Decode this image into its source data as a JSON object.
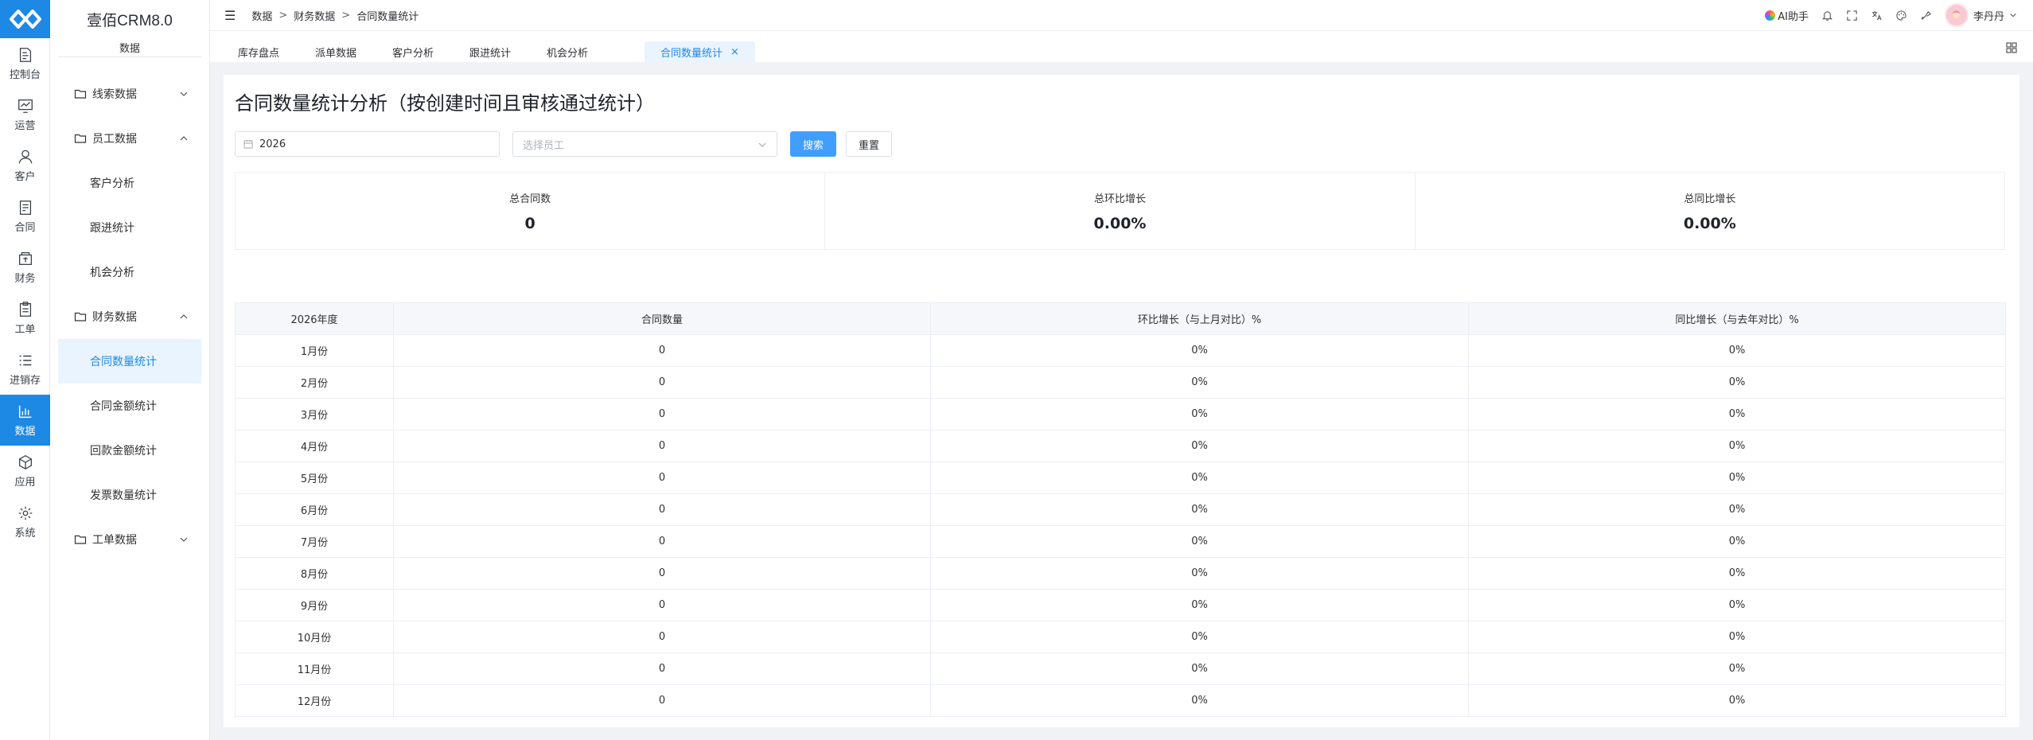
{
  "app": {
    "title": "壹佰CRM8.0"
  },
  "rail": {
    "items": [
      {
        "label": "控制台",
        "icon": "dashboard-icon"
      },
      {
        "label": "运营",
        "icon": "operations-icon"
      },
      {
        "label": "客户",
        "icon": "customer-icon"
      },
      {
        "label": "合同",
        "icon": "contract-icon"
      },
      {
        "label": "财务",
        "icon": "finance-icon"
      },
      {
        "label": "工单",
        "icon": "ticket-icon"
      },
      {
        "label": "进销存",
        "icon": "inventory-icon"
      },
      {
        "label": "数据",
        "icon": "data-icon",
        "active": true
      },
      {
        "label": "应用",
        "icon": "apps-icon"
      },
      {
        "label": "系统",
        "icon": "system-icon"
      }
    ]
  },
  "sidebar": {
    "section_title": "数据",
    "groups": [
      {
        "label": "线索数据",
        "expanded": false
      },
      {
        "label": "员工数据",
        "expanded": true,
        "items": [
          "客户分析",
          "跟进统计",
          "机会分析"
        ]
      },
      {
        "label": "财务数据",
        "expanded": true,
        "items": [
          "合同数量统计",
          "合同金额统计",
          "回款金额统计",
          "发票数量统计"
        ],
        "active_item": "合同数量统计"
      },
      {
        "label": "工单数据",
        "expanded": false
      }
    ]
  },
  "header": {
    "breadcrumb": [
      "数据",
      "财务数据",
      "合同数量统计"
    ],
    "separator": ">",
    "ai_helper": "AI助手",
    "user_name": "李丹丹"
  },
  "tabs": [
    {
      "label": "库存盘点"
    },
    {
      "label": "派单数据"
    },
    {
      "label": "客户分析"
    },
    {
      "label": "跟进统计"
    },
    {
      "label": "机会分析"
    },
    {
      "label": "合同数量统计",
      "active": true,
      "close": "×"
    }
  ],
  "page": {
    "title": "合同数量统计分析（按创建时间且审核通过统计）",
    "filters": {
      "year_value": "2026",
      "employee_placeholder": "选择员工",
      "search_label": "搜索",
      "reset_label": "重置"
    },
    "stats": [
      {
        "label": "总合同数",
        "value": "0"
      },
      {
        "label": "总环比增长",
        "value": "0.00%"
      },
      {
        "label": "总同比增长",
        "value": "0.00%"
      }
    ],
    "table": {
      "columns": [
        "2026年度",
        "合同数量",
        "环比增长（与上月对比）%",
        "同比增长（与去年对比）%"
      ],
      "rows": [
        [
          "1月份",
          "0",
          "0%",
          "0%"
        ],
        [
          "2月份",
          "0",
          "0%",
          "0%"
        ],
        [
          "3月份",
          "0",
          "0%",
          "0%"
        ],
        [
          "4月份",
          "0",
          "0%",
          "0%"
        ],
        [
          "5月份",
          "0",
          "0%",
          "0%"
        ],
        [
          "6月份",
          "0",
          "0%",
          "0%"
        ],
        [
          "7月份",
          "0",
          "0%",
          "0%"
        ],
        [
          "8月份",
          "0",
          "0%",
          "0%"
        ],
        [
          "9月份",
          "0",
          "0%",
          "0%"
        ],
        [
          "10月份",
          "0",
          "0%",
          "0%"
        ],
        [
          "11月份",
          "0",
          "0%",
          "0%"
        ],
        [
          "12月份",
          "0",
          "0%",
          "0%"
        ]
      ]
    }
  },
  "colors": {
    "accent": "#1e88e5",
    "primary_button": "#409eff",
    "active_bg": "#eaf4ff"
  }
}
